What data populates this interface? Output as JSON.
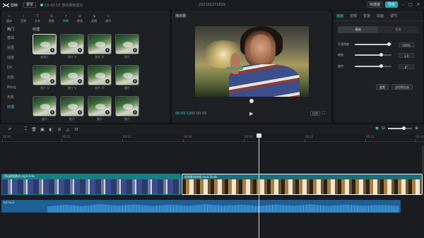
{
  "titlebar": {
    "app_name": "剪映",
    "menu_label": "菜单",
    "autosave": "15:43:10 自动保存成功",
    "doc_title": "202102271819",
    "shortcut_label": "快捷键",
    "export_label": "导出"
  },
  "toolbar": {
    "items": [
      {
        "label": "媒体",
        "icon": "media-icon"
      },
      {
        "label": "音频",
        "icon": "audio-icon"
      },
      {
        "label": "文本",
        "icon": "text-icon"
      },
      {
        "label": "贴纸",
        "icon": "sticker-icon"
      },
      {
        "label": "特效",
        "icon": "effects-icon"
      },
      {
        "label": "转场",
        "icon": "transition-icon"
      },
      {
        "label": "滤镜",
        "icon": "filter-icon"
      },
      {
        "label": "调节",
        "icon": "adjust-icon"
      }
    ],
    "active_index": 4
  },
  "categories": {
    "top": "热门",
    "items": [
      "基础",
      "氛围",
      "动感",
      "DV",
      "光影",
      "Bling",
      "光影",
      "纹理"
    ],
    "active_index": 7
  },
  "effects": {
    "section_title": "纹理",
    "items": [
      {
        "name": "老照片"
      },
      {
        "name": "胶片 II"
      },
      {
        "name": "胶片 III"
      },
      {
        "name": "胶片"
      },
      {
        "name": "胶片 II"
      },
      {
        "name": "胶片 V"
      },
      {
        "name": "胶片 VI"
      },
      {
        "name": "胶片"
      },
      {
        "name": "胶片"
      },
      {
        "name": "胶片"
      },
      {
        "name": "胶片"
      },
      {
        "name": "胶片"
      }
    ],
    "selected_index": 0
  },
  "player": {
    "title": "播放器",
    "current_time": "00:00:12",
    "total_time": "00:00:56",
    "ratio_label": "比例",
    "play_icon": "play-icon",
    "fullscreen_icon": "fullscreen-icon"
  },
  "properties": {
    "tabs": [
      "画面",
      "音频",
      "变速",
      "动画",
      "调节"
    ],
    "active_tab": 0,
    "subtabs": [
      "基础",
      "抠像"
    ],
    "active_subtab": 0,
    "rows": [
      {
        "label": "不透明度",
        "value": "100%",
        "level": 0.92
      },
      {
        "label": "缩放",
        "value": "1.0",
        "level": 0.72
      },
      {
        "label": "旋转",
        "value": "0°",
        "level": 0.72
      }
    ],
    "buttons": [
      "重置",
      "应用到全部"
    ]
  },
  "timeline": {
    "ticks": [
      "00:00",
      "00:01",
      "00:03",
      "00:06",
      "00:09",
      "00:12",
      "00:15",
      "00:18"
    ],
    "zoom_level": 0.6,
    "clips": [
      {
        "name": "代码视频素材.mp4  4.9s"
      },
      {
        "name": "视频素材拼接.mp4  29.8s"
      }
    ],
    "audio": {
      "name": "bd.mp3"
    }
  }
}
